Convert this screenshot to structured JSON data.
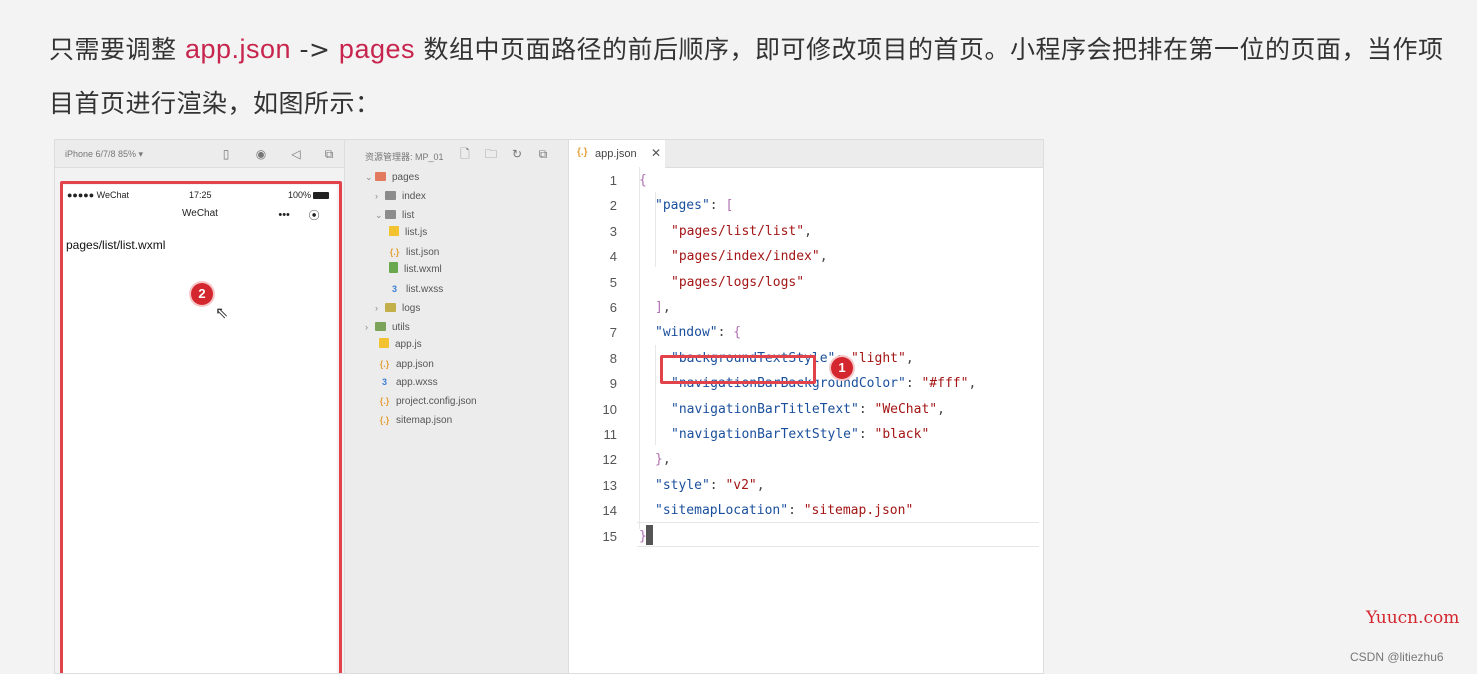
{
  "intro": {
    "part1": "只需要调整 ",
    "code1": "app.json",
    "part2": " -> ",
    "code2": "pages",
    "part3": " 数组中页面路径的前后顺序，即可修改项目的首页。小程序会把排在第一位的页面，当作项目首页进行渲染，如图所示："
  },
  "simulator": {
    "device_label": "iPhone 6/7/8 85% ▾",
    "status_left": "●●●●● WeChat",
    "status_time": "17:25",
    "status_battery": "100%",
    "nav_title": "WeChat",
    "capsule_more": "•••",
    "capsule_close": "⦿",
    "page_text": "pages/list/list.wxml"
  },
  "badges": {
    "one": "1",
    "two": "2"
  },
  "explorer": {
    "header_label": "资源管理器: MP_01",
    "items": [
      {
        "label": "pages",
        "icon": "folder-red",
        "chev": "v"
      },
      {
        "label": "index",
        "icon": "folder",
        "chev": ">"
      },
      {
        "label": "list",
        "icon": "folder",
        "chev": "v"
      },
      {
        "label": "list.js",
        "icon": "js",
        "chev": ""
      },
      {
        "label": "list.json",
        "icon": "json",
        "chev": ""
      },
      {
        "label": "list.wxml",
        "icon": "wxml",
        "chev": ""
      },
      {
        "label": "list.wxss",
        "icon": "wxss",
        "chev": ""
      },
      {
        "label": "logs",
        "icon": "folder-yellow",
        "chev": ">"
      },
      {
        "label": "utils",
        "icon": "folder-green",
        "chev": ">"
      },
      {
        "label": "app.js",
        "icon": "js",
        "chev": ""
      },
      {
        "label": "app.json",
        "icon": "json",
        "chev": ""
      },
      {
        "label": "app.wxss",
        "icon": "wxss",
        "chev": ""
      },
      {
        "label": "project.config.json",
        "icon": "json",
        "chev": ""
      },
      {
        "label": "sitemap.json",
        "icon": "json",
        "chev": ""
      }
    ]
  },
  "editor": {
    "tab_icon": "{.}",
    "tab_name": "app.json",
    "tab_close": "✕",
    "lines": [
      {
        "n": "1",
        "tokens": [
          [
            "bk",
            "{"
          ]
        ]
      },
      {
        "n": "2",
        "tokens": [
          [
            "k",
            "\"pages\""
          ],
          [
            "p",
            ": "
          ],
          [
            "bk",
            "["
          ]
        ]
      },
      {
        "n": "3",
        "tokens": [
          [
            "s",
            "\"pages/list/list\""
          ],
          [
            "p",
            ","
          ]
        ]
      },
      {
        "n": "4",
        "tokens": [
          [
            "s",
            "\"pages/index/index\""
          ],
          [
            "p",
            ","
          ]
        ]
      },
      {
        "n": "5",
        "tokens": [
          [
            "s",
            "\"pages/logs/logs\""
          ]
        ]
      },
      {
        "n": "6",
        "tokens": [
          [
            "bk",
            "]"
          ],
          [
            "p",
            ","
          ]
        ]
      },
      {
        "n": "7",
        "tokens": [
          [
            "k",
            "\"window\""
          ],
          [
            "p",
            ": "
          ],
          [
            "bk",
            "{"
          ]
        ]
      },
      {
        "n": "8",
        "tokens": [
          [
            "k",
            "\"backgroundTextStyle\""
          ],
          [
            "p",
            ": "
          ],
          [
            "s",
            "\"light\""
          ],
          [
            "p",
            ","
          ]
        ]
      },
      {
        "n": "9",
        "tokens": [
          [
            "k",
            "\"navigationBarBackgroundColor\""
          ],
          [
            "p",
            ": "
          ],
          [
            "s",
            "\"#fff\""
          ],
          [
            "p",
            ","
          ]
        ]
      },
      {
        "n": "10",
        "tokens": [
          [
            "k",
            "\"navigationBarTitleText\""
          ],
          [
            "p",
            ": "
          ],
          [
            "s",
            "\"WeChat\""
          ],
          [
            "p",
            ","
          ]
        ]
      },
      {
        "n": "11",
        "tokens": [
          [
            "k",
            "\"navigationBarTextStyle\""
          ],
          [
            "p",
            ": "
          ],
          [
            "s",
            "\"black\""
          ]
        ]
      },
      {
        "n": "12",
        "tokens": [
          [
            "bk",
            "}"
          ],
          [
            "p",
            ","
          ]
        ]
      },
      {
        "n": "13",
        "tokens": [
          [
            "k",
            "\"style\""
          ],
          [
            "p",
            ": "
          ],
          [
            "s",
            "\"v2\""
          ],
          [
            "p",
            ","
          ]
        ]
      },
      {
        "n": "14",
        "tokens": [
          [
            "k",
            "\"sitemapLocation\""
          ],
          [
            "p",
            ": "
          ],
          [
            "s",
            "\"sitemap.json\""
          ]
        ]
      },
      {
        "n": "15",
        "tokens": [
          [
            "bk",
            "}"
          ]
        ]
      }
    ]
  },
  "watermark": "Yuucn.com",
  "credit": "CSDN @litiezhu6",
  "colors": {
    "highlight_red": "#e2434b",
    "code_key": "#1a4f9c",
    "code_string": "#a31515"
  }
}
